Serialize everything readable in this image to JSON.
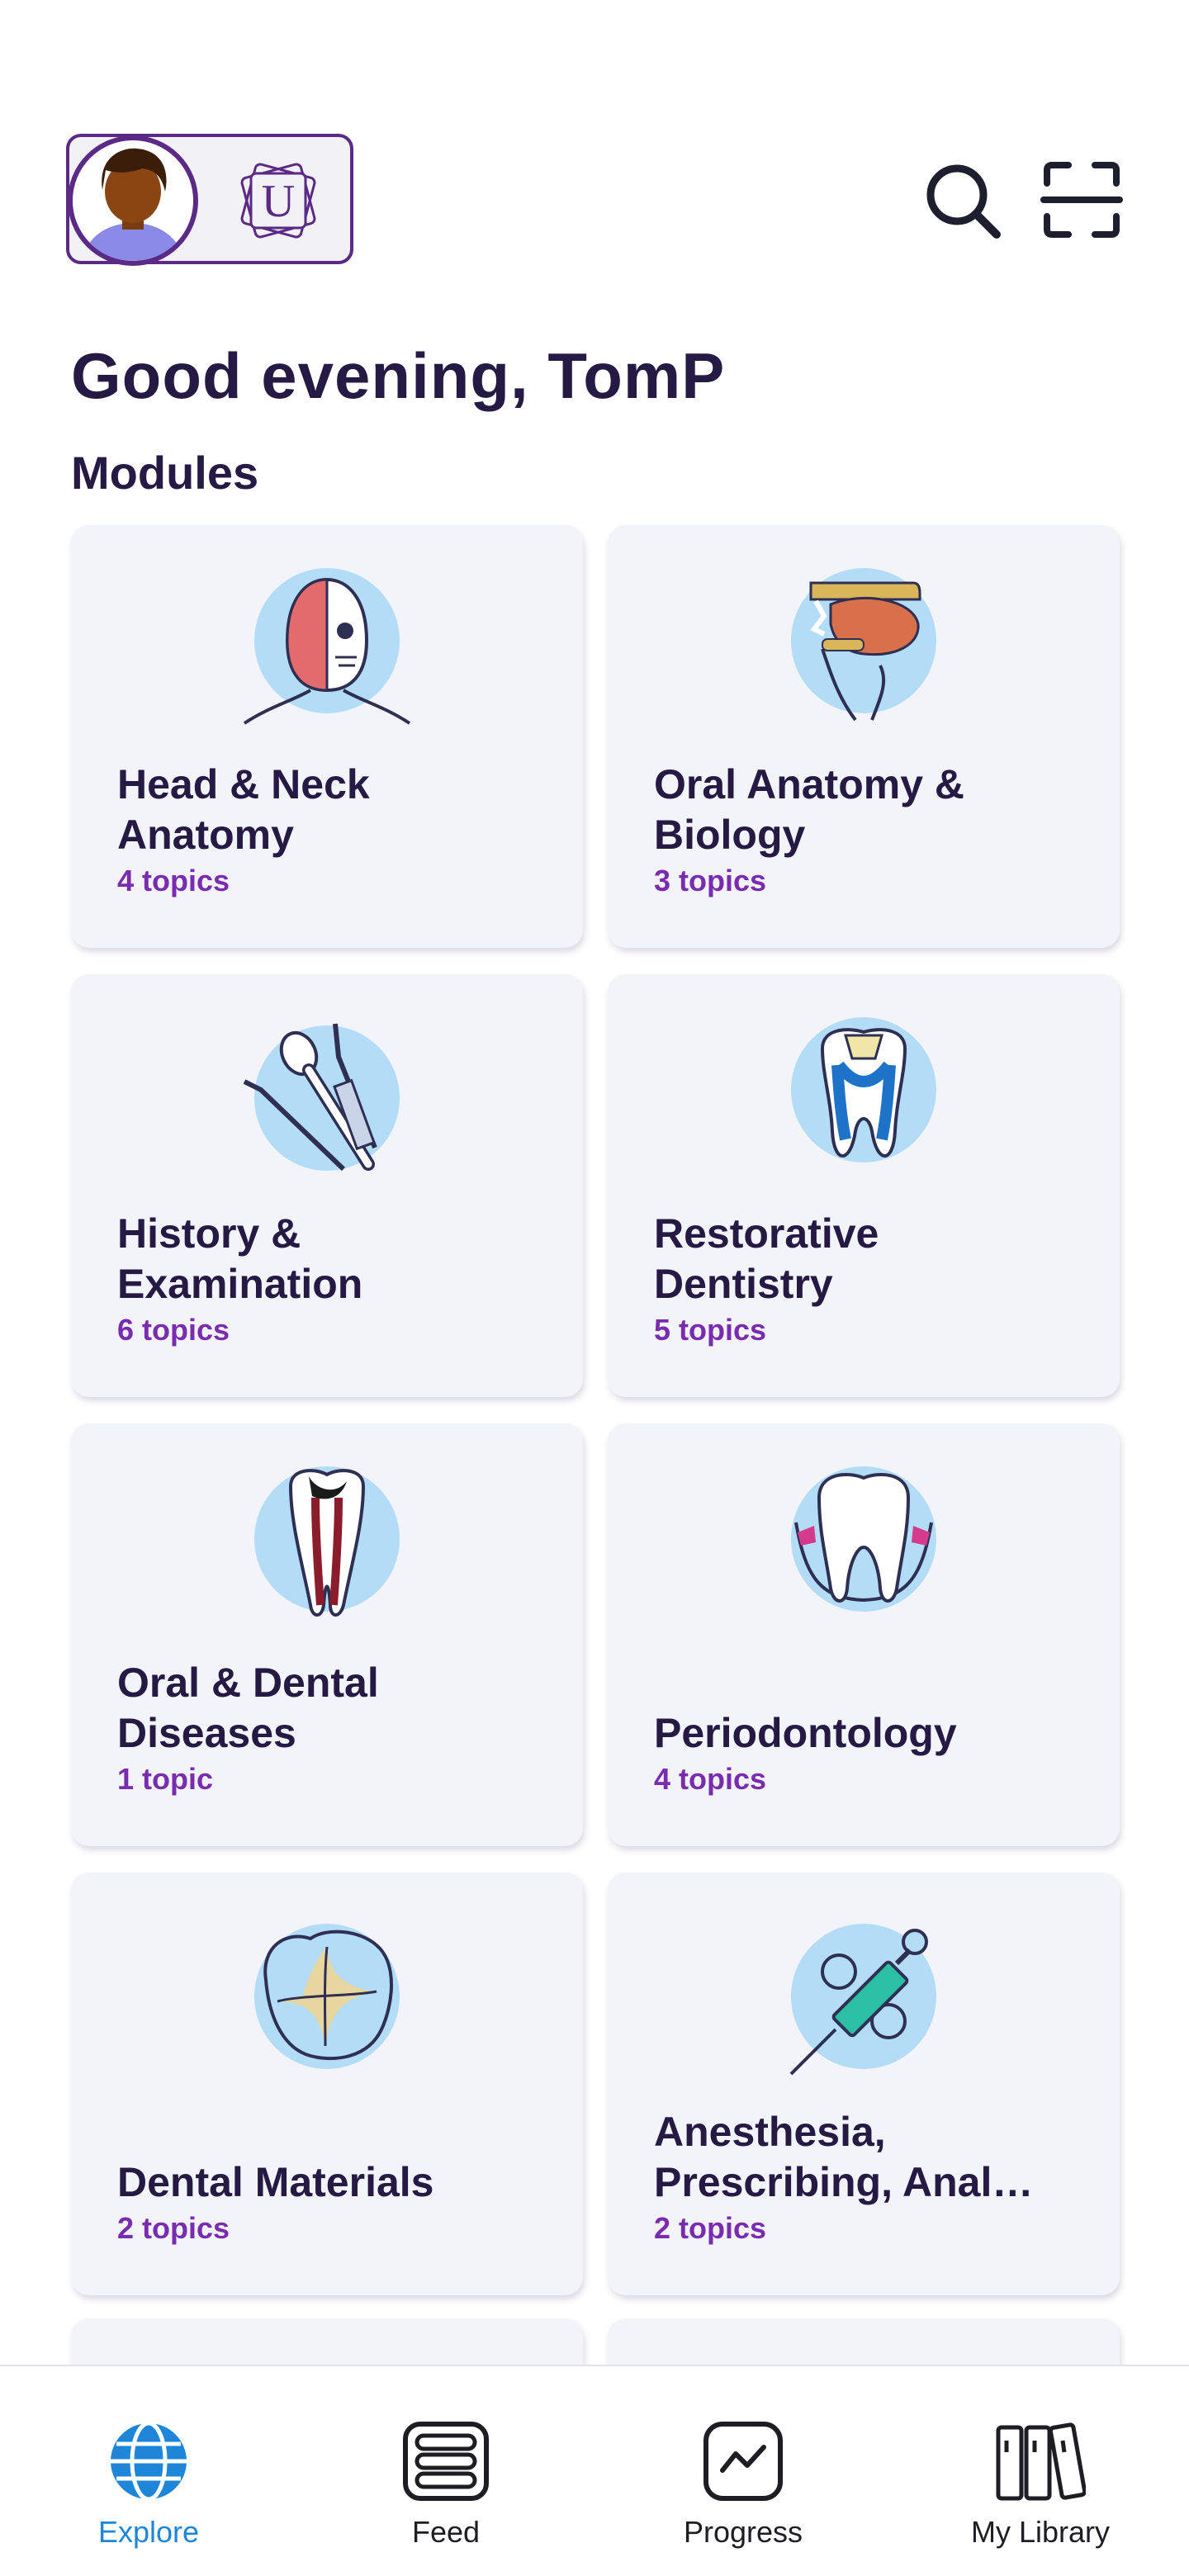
{
  "header": {
    "avatar_alt": "user avatar",
    "org_logo_letter": "U"
  },
  "greeting": "Good evening, TomP",
  "modules_title": "Modules",
  "modules": [
    {
      "title": "Head & Neck\nAnatomy",
      "topics": "4 topics",
      "icon": "head-neck-icon"
    },
    {
      "title": "Oral Anatomy &\nBiology",
      "topics": "3 topics",
      "icon": "oral-anatomy-icon"
    },
    {
      "title": "History &\nExamination",
      "topics": "6 topics",
      "icon": "dental-instruments-icon"
    },
    {
      "title": "Restorative\nDentistry",
      "topics": "5 topics",
      "icon": "tooth-filling-icon"
    },
    {
      "title": "Oral & Dental\nDiseases",
      "topics": "1 topic",
      "icon": "tooth-decay-icon"
    },
    {
      "title": "Periodontology",
      "topics": "4 topics",
      "icon": "tooth-gums-icon"
    },
    {
      "title": "Dental Materials",
      "topics": "2 topics",
      "icon": "dental-material-icon"
    },
    {
      "title": "Anesthesia,\nPrescribing, Anal…",
      "topics": "2 topics",
      "icon": "syringe-icon"
    }
  ],
  "nav": {
    "explore": "Explore",
    "feed": "Feed",
    "progress": "Progress",
    "library": "My Library"
  },
  "colors": {
    "accent": "#5b2a86",
    "topics": "#7a2cb0",
    "active_nav": "#1e86d8",
    "card_bg": "#f3f3fa",
    "icon_circle": "#b3dcf7"
  }
}
